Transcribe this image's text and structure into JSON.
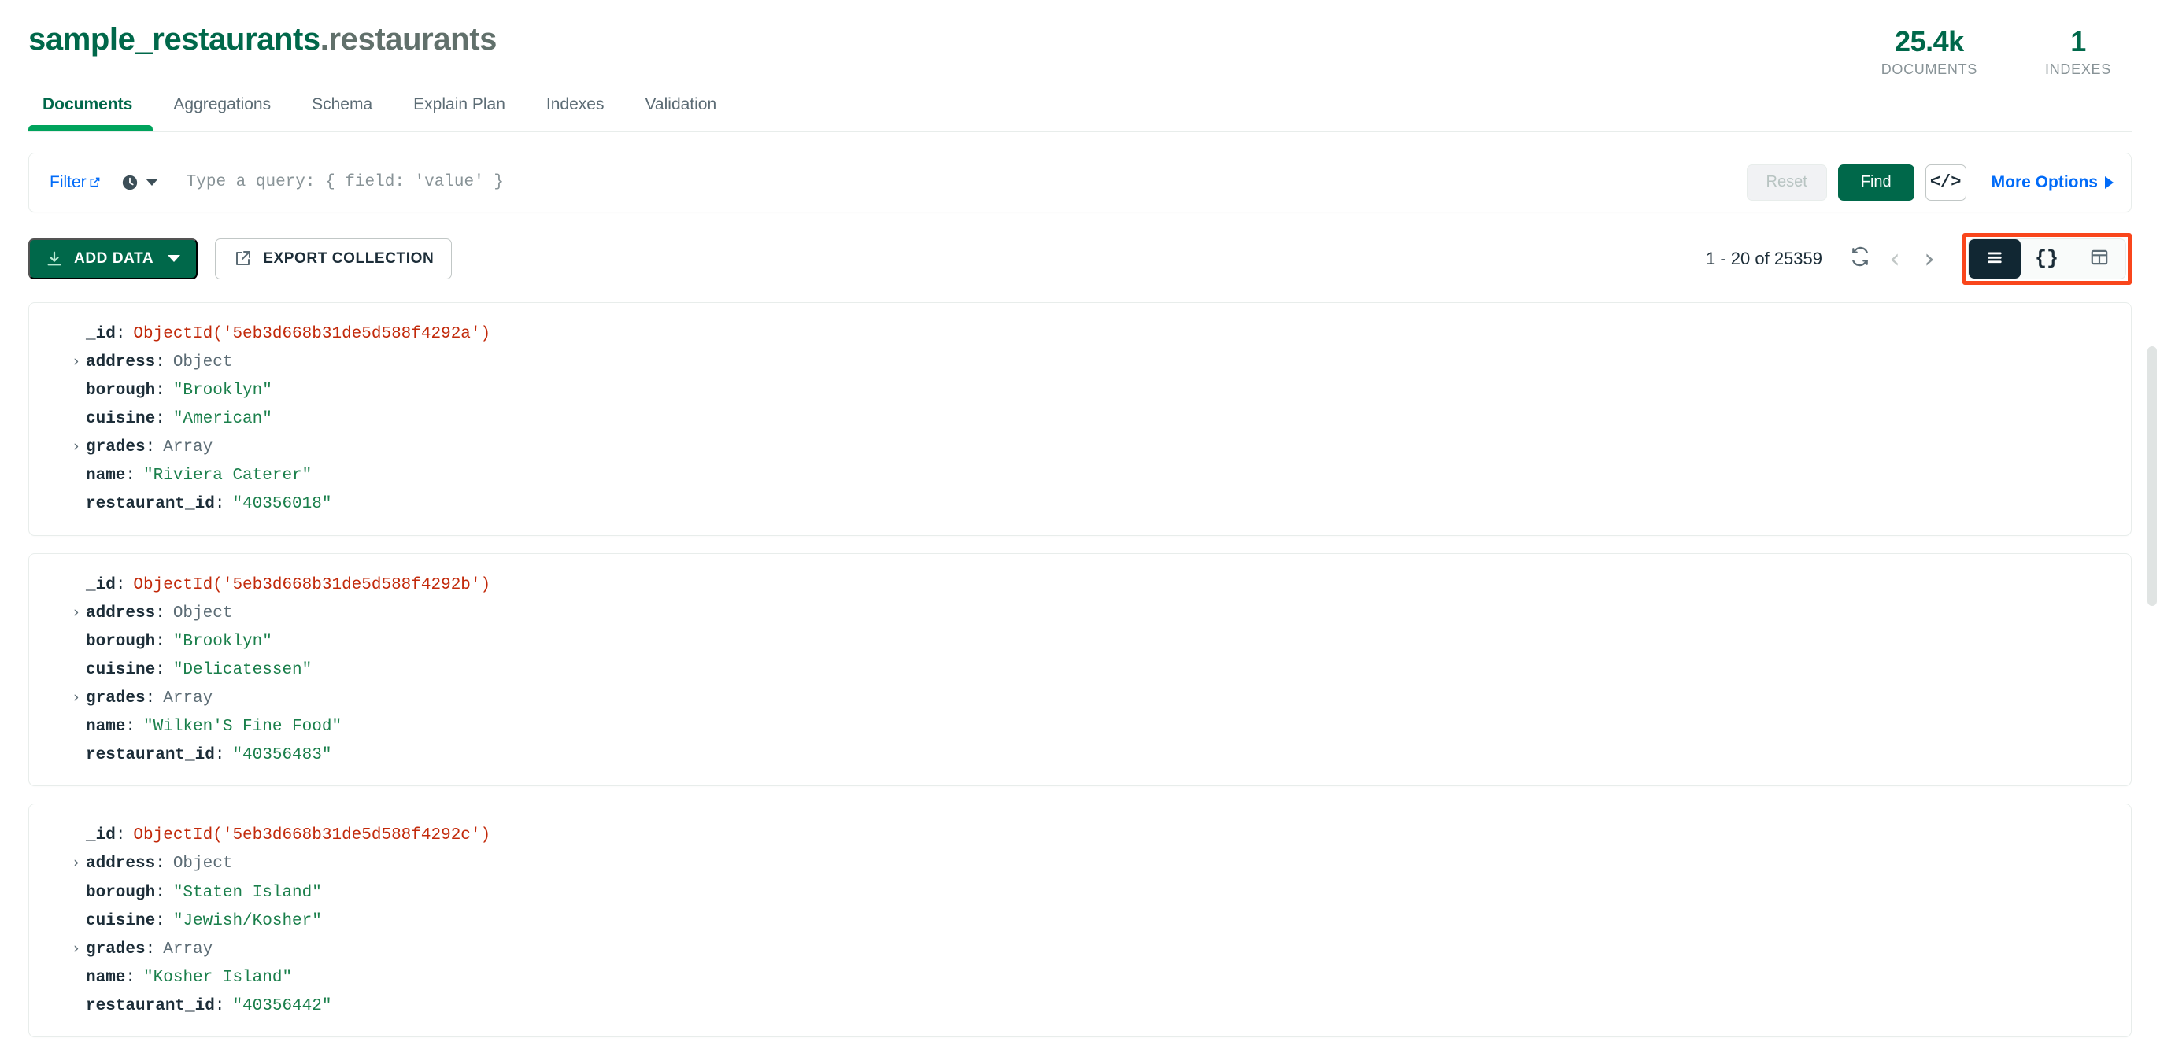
{
  "header": {
    "namespace_db": "sample_restaurants",
    "namespace_collection": ".restaurants",
    "stats": [
      {
        "value": "25.4k",
        "label": "DOCUMENTS"
      },
      {
        "value": "1",
        "label": "INDEXES"
      }
    ]
  },
  "tabs": [
    {
      "label": "Documents",
      "active": true
    },
    {
      "label": "Aggregations",
      "active": false
    },
    {
      "label": "Schema",
      "active": false
    },
    {
      "label": "Explain Plan",
      "active": false
    },
    {
      "label": "Indexes",
      "active": false
    },
    {
      "label": "Validation",
      "active": false
    }
  ],
  "querybar": {
    "filter_label": "Filter",
    "query_value": "",
    "query_placeholder": "Type a query: { field: 'value' }",
    "reset_label": "Reset",
    "find_label": "Find",
    "code_label": "</>",
    "more_options_label": "More Options",
    "history_icon": "clock-icon",
    "external_link_icon": "external-link-icon"
  },
  "toolbar": {
    "add_data_label": "ADD DATA",
    "export_collection_label": "EXPORT COLLECTION",
    "range_text": "1 - 20 of 25359",
    "refresh_icon": "refresh-icon",
    "prev_icon": "chevron-left-icon",
    "next_icon": "chevron-right-icon",
    "prev_glyph": "‹",
    "next_glyph": "›",
    "views": [
      {
        "name": "list-view",
        "icon": "list-icon",
        "label": "",
        "active": true
      },
      {
        "name": "json-view",
        "icon": "braces-icon",
        "label": "{}",
        "active": false
      },
      {
        "name": "table-view",
        "icon": "table-icon",
        "label": "",
        "active": false
      }
    ],
    "highlight_color": "#F9461C"
  },
  "colors": {
    "brand_green": "#00684A",
    "accent_green": "#00A35C",
    "link_blue": "#016BF8",
    "string_green": "#1A7F4B",
    "objectid_red": "#C2290A",
    "dark_navy": "#112733",
    "annotation_red": "#F9461C"
  },
  "documents": [
    {
      "fields": [
        {
          "key": "_id",
          "value": "ObjectId('5eb3d668b31de5d588f4292a')",
          "type": "objectid",
          "expandable": false
        },
        {
          "key": "address",
          "value": "Object",
          "type": "type",
          "expandable": true
        },
        {
          "key": "borough",
          "value": "\"Brooklyn\"",
          "type": "string",
          "expandable": false
        },
        {
          "key": "cuisine",
          "value": "\"American\"",
          "type": "string",
          "expandable": false
        },
        {
          "key": "grades",
          "value": "Array",
          "type": "type",
          "expandable": true
        },
        {
          "key": "name",
          "value": "\"Riviera Caterer\"",
          "type": "string",
          "expandable": false
        },
        {
          "key": "restaurant_id",
          "value": "\"40356018\"",
          "type": "string",
          "expandable": false
        }
      ]
    },
    {
      "fields": [
        {
          "key": "_id",
          "value": "ObjectId('5eb3d668b31de5d588f4292b')",
          "type": "objectid",
          "expandable": false
        },
        {
          "key": "address",
          "value": "Object",
          "type": "type",
          "expandable": true
        },
        {
          "key": "borough",
          "value": "\"Brooklyn\"",
          "type": "string",
          "expandable": false
        },
        {
          "key": "cuisine",
          "value": "\"Delicatessen\"",
          "type": "string",
          "expandable": false
        },
        {
          "key": "grades",
          "value": "Array",
          "type": "type",
          "expandable": true
        },
        {
          "key": "name",
          "value": "\"Wilken'S Fine Food\"",
          "type": "string",
          "expandable": false
        },
        {
          "key": "restaurant_id",
          "value": "\"40356483\"",
          "type": "string",
          "expandable": false
        }
      ]
    },
    {
      "fields": [
        {
          "key": "_id",
          "value": "ObjectId('5eb3d668b31de5d588f4292c')",
          "type": "objectid",
          "expandable": false
        },
        {
          "key": "address",
          "value": "Object",
          "type": "type",
          "expandable": true
        },
        {
          "key": "borough",
          "value": "\"Staten Island\"",
          "type": "string",
          "expandable": false
        },
        {
          "key": "cuisine",
          "value": "\"Jewish/Kosher\"",
          "type": "string",
          "expandable": false
        },
        {
          "key": "grades",
          "value": "Array",
          "type": "type",
          "expandable": true
        },
        {
          "key": "name",
          "value": "\"Kosher Island\"",
          "type": "string",
          "expandable": false
        },
        {
          "key": "restaurant_id",
          "value": "\"40356442\"",
          "type": "string",
          "expandable": false
        }
      ]
    }
  ]
}
